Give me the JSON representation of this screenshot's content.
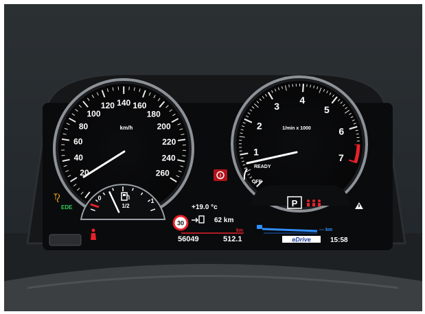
{
  "speedometer": {
    "unit": "km/h",
    "ticks": [
      {
        "v": 20,
        "t": "20"
      },
      {
        "v": 40,
        "t": "40"
      },
      {
        "v": 60,
        "t": "60"
      },
      {
        "v": 80,
        "t": "80"
      },
      {
        "v": 100,
        "t": "100"
      },
      {
        "v": 120,
        "t": "120"
      },
      {
        "v": 140,
        "t": "140"
      },
      {
        "v": 160,
        "t": "160"
      },
      {
        "v": 180,
        "t": "180"
      },
      {
        "v": 200,
        "t": "200"
      },
      {
        "v": 220,
        "t": "220"
      },
      {
        "v": 240,
        "t": "240"
      },
      {
        "v": 260,
        "t": "260"
      }
    ],
    "min": 0,
    "max": 260,
    "needle_value": 0
  },
  "tachometer": {
    "unit": "1/min x 1000",
    "ticks": [
      {
        "v": 1,
        "t": "1"
      },
      {
        "v": 2,
        "t": "2"
      },
      {
        "v": 3,
        "t": "3"
      },
      {
        "v": 4,
        "t": "4"
      },
      {
        "v": 5,
        "t": "5"
      },
      {
        "v": 6,
        "t": "6"
      },
      {
        "v": 7,
        "t": "7"
      }
    ],
    "ready_label": "READY",
    "off_label": "OFF",
    "needle": "READY"
  },
  "fuel_gauge": {
    "empty_label": "0",
    "half_label": "1/2",
    "full_label": "1",
    "level": 0.5
  },
  "center": {
    "temperature": "+19.0 °c",
    "speed_limit": "30",
    "range_value": "62 km",
    "km_unit": "km"
  },
  "bottom_bar": {
    "odometer": "56049",
    "trip": "512.1",
    "electric_range": "--- km",
    "edrive_label": "eDrive",
    "time": "15:58"
  },
  "gear": "P",
  "indicator_labels": {
    "eco": "EDE"
  },
  "colors": {
    "accent_red": "#e8222a",
    "warning_amber": "#f0a020",
    "edrive_blue": "#2f8fff",
    "eco_green": "#33d05a"
  }
}
